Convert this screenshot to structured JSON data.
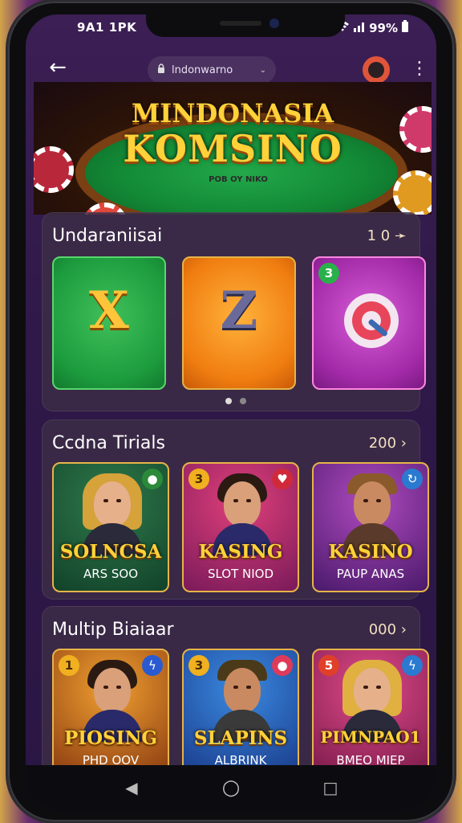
{
  "status": {
    "time": "9A1 1PK",
    "battery": "99%"
  },
  "browser": {
    "url": "lndonwarno",
    "url_chevron": "⌄"
  },
  "banner": {
    "line1": "MINDONASIA",
    "line2": "KOMSINO",
    "sub": "POB OY NIKO"
  },
  "section1": {
    "title": "Undaraniisai",
    "more": "1 0 ➛",
    "tiles": [
      {
        "symbol": "X"
      },
      {
        "symbol": "Z"
      },
      {
        "badge": "3"
      }
    ]
  },
  "section2": {
    "title": "Ccdna Tirials",
    "more": "200 ›",
    "games": [
      {
        "name": "SOLNCSA",
        "sub": "ARS SOO"
      },
      {
        "name": "KASING",
        "sub": "SLOT NIOD",
        "badge": "3"
      },
      {
        "name": "KASINO",
        "sub": "PAUP ANAS"
      }
    ]
  },
  "section3": {
    "title": "Multip Biaiaar",
    "more": "000 ›",
    "games": [
      {
        "name": "PIOSING",
        "sub": "PHD OOV",
        "badge": "1"
      },
      {
        "name": "SLAPINS",
        "sub": "ALBRINK",
        "badge": "3"
      },
      {
        "name": "PIMNPAO1",
        "sub": "BMEO MIEP",
        "badge": "5"
      }
    ]
  },
  "nav": {
    "back": "◀",
    "home": "○",
    "recents": "□"
  },
  "colors": {
    "accent": "#ffd23a",
    "bg": "#2f1948"
  }
}
